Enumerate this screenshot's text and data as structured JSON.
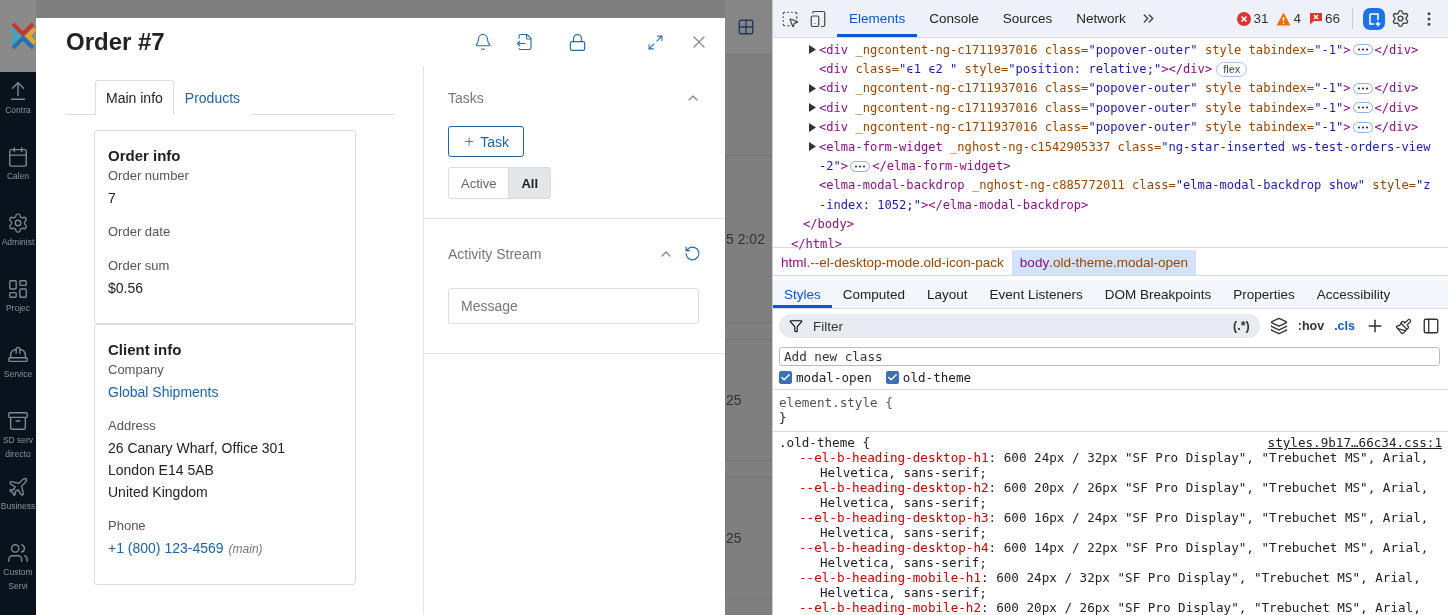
{
  "app_sidebar": {
    "items": [
      {
        "lines": [
          "Contra"
        ]
      },
      {
        "lines": [
          "Calen"
        ]
      },
      {
        "lines": [
          "Administ"
        ]
      },
      {
        "lines": [
          "Projec"
        ]
      },
      {
        "lines": [
          "Service"
        ]
      },
      {
        "lines": [
          "SD serv",
          "directo"
        ]
      },
      {
        "lines": [
          "Business"
        ]
      },
      {
        "lines": [
          "Custom",
          "Servi"
        ]
      }
    ]
  },
  "background": {
    "cards": [
      "5 2:02",
      "25",
      "25"
    ]
  },
  "modal": {
    "title": "Order #7",
    "tabs": [
      {
        "label": "Main info",
        "selected": true
      },
      {
        "label": "Products",
        "selected": false
      }
    ],
    "cards": [
      {
        "title": "Order info",
        "fields": [
          {
            "label": "Order number",
            "lines": [
              "7"
            ],
            "kind": "text"
          },
          {
            "label": "Order date"
          },
          {
            "label": "Order sum",
            "lines": [
              "$0.56"
            ],
            "kind": "text"
          }
        ]
      },
      {
        "title": "Client info",
        "fields": [
          {
            "label": "Company",
            "lines": [
              "Global Shipments"
            ],
            "kind": "link"
          },
          {
            "label": "Address",
            "lines": [
              "26 Canary Wharf, Office 301",
              "London E14 5AB",
              "United Kingdom"
            ],
            "kind": "text"
          },
          {
            "label": "Phone",
            "lines": [
              "+1 (800) 123-4569"
            ],
            "note": "(main)",
            "kind": "link"
          }
        ]
      }
    ],
    "tasks": {
      "title": "Tasks",
      "expanded": true,
      "add_button": "Task",
      "filters": [
        {
          "label": "Active",
          "selected": false
        },
        {
          "label": "All",
          "selected": true
        }
      ]
    },
    "activity": {
      "title": "Activity Stream",
      "expanded": true,
      "message_placeholder": "Message"
    }
  },
  "devtools": {
    "tabs": [
      {
        "label": "Elements",
        "selected": true
      },
      {
        "label": "Console",
        "selected": false
      },
      {
        "label": "Sources",
        "selected": false
      },
      {
        "label": "Network",
        "selected": false
      }
    ],
    "counters": [
      {
        "kind": "error",
        "count": "31"
      },
      {
        "kind": "warning",
        "count": "4"
      },
      {
        "kind": "issue",
        "count": "66"
      }
    ],
    "dom_lines": [
      {
        "kind": "expandable",
        "segments": [
          {
            "kind": "code",
            "tokens": [
              {
                "kind": "tag",
                "text": "<div"
              },
              {
                "kind": "attr",
                "text": " _ngcontent-ng-c1711937016 class="
              },
              {
                "kind": "value",
                "text": "\"popover-outer\""
              },
              {
                "kind": "attr",
                "text": " style tabindex="
              },
              {
                "kind": "value",
                "text": "\"-1\""
              },
              {
                "kind": "tag",
                "text": ">"
              }
            ]
          },
          {
            "kind": "ellipsis"
          },
          {
            "kind": "code",
            "tokens": [
              {
                "kind": "tag",
                "text": "</div>"
              }
            ]
          }
        ]
      },
      {
        "kind": "plain",
        "segments": [
          {
            "kind": "code",
            "tokens": [
              {
                "kind": "tag",
                "text": "<div"
              },
              {
                "kind": "attr",
                "text": " class="
              },
              {
                "kind": "value",
                "text": "\"ϵ1 ϵ2 \""
              },
              {
                "kind": "attr",
                "text": " style="
              },
              {
                "kind": "value",
                "text": "\"position: relative;\""
              },
              {
                "kind": "tag",
                "text": "></div>"
              }
            ]
          },
          {
            "kind": "badge",
            "text": "flex"
          }
        ]
      },
      {
        "kind": "expandable",
        "segments": [
          {
            "kind": "code",
            "tokens": [
              {
                "kind": "tag",
                "text": "<div"
              },
              {
                "kind": "attr",
                "text": " _ngcontent-ng-c1711937016 class="
              },
              {
                "kind": "value",
                "text": "\"popover-outer\""
              },
              {
                "kind": "attr",
                "text": " style tabindex="
              },
              {
                "kind": "value",
                "text": "\"-1\""
              },
              {
                "kind": "tag",
                "text": ">"
              }
            ]
          },
          {
            "kind": "ellipsis"
          },
          {
            "kind": "code",
            "tokens": [
              {
                "kind": "tag",
                "text": "</div>"
              }
            ]
          }
        ]
      },
      {
        "kind": "expandable",
        "segments": [
          {
            "kind": "code",
            "tokens": [
              {
                "kind": "tag",
                "text": "<div"
              },
              {
                "kind": "attr",
                "text": " _ngcontent-ng-c1711937016 class="
              },
              {
                "kind": "value",
                "text": "\"popover-outer\""
              },
              {
                "kind": "attr",
                "text": " style tabindex="
              },
              {
                "kind": "value",
                "text": "\"-1\""
              },
              {
                "kind": "tag",
                "text": ">"
              }
            ]
          },
          {
            "kind": "ellipsis"
          },
          {
            "kind": "code",
            "tokens": [
              {
                "kind": "tag",
                "text": "</div>"
              }
            ]
          }
        ]
      },
      {
        "kind": "expandable",
        "segments": [
          {
            "kind": "code",
            "tokens": [
              {
                "kind": "tag",
                "text": "<div"
              },
              {
                "kind": "attr",
                "text": " _ngcontent-ng-c1711937016 class="
              },
              {
                "kind": "value",
                "text": "\"popover-outer\""
              },
              {
                "kind": "attr",
                "text": " style tabindex="
              },
              {
                "kind": "value",
                "text": "\"-1\""
              },
              {
                "kind": "tag",
                "text": ">"
              }
            ]
          },
          {
            "kind": "ellipsis"
          },
          {
            "kind": "code",
            "tokens": [
              {
                "kind": "tag",
                "text": "</div>"
              }
            ]
          }
        ]
      },
      {
        "kind": "expandable",
        "segments": [
          {
            "kind": "code",
            "tokens": [
              {
                "kind": "tag",
                "text": "<elma-form-widget"
              },
              {
                "kind": "attr",
                "text": " _nghost-ng-c1542905337 class="
              },
              {
                "kind": "value",
                "text": "\"ng-star-inserted ws-test-orders-view"
              }
            ]
          }
        ]
      },
      {
        "kind": "wrap",
        "segments": [
          {
            "kind": "code",
            "tokens": [
              {
                "kind": "value",
                "text": "-2\""
              },
              {
                "kind": "tag",
                "text": ">"
              }
            ]
          },
          {
            "kind": "ellipsis"
          },
          {
            "kind": "code",
            "tokens": [
              {
                "kind": "tag",
                "text": "</elma-form-widget>"
              }
            ]
          }
        ]
      },
      {
        "kind": "plain",
        "segments": [
          {
            "kind": "code",
            "tokens": [
              {
                "kind": "tag",
                "text": "<elma-modal-backdrop"
              },
              {
                "kind": "attr",
                "text": " _nghost-ng-c885772011 class="
              },
              {
                "kind": "value",
                "text": "\"elma-modal-backdrop show\""
              },
              {
                "kind": "attr",
                "text": " style="
              },
              {
                "kind": "value",
                "text": "\"z"
              }
            ]
          }
        ]
      },
      {
        "kind": "wrap",
        "segments": [
          {
            "kind": "code",
            "tokens": [
              {
                "kind": "value",
                "text": "-index: 1052;\""
              },
              {
                "kind": "tag",
                "text": "></elma-modal-backdrop>"
              }
            ]
          }
        ]
      },
      {
        "kind": "body",
        "segments": [
          {
            "kind": "code",
            "tokens": [
              {
                "kind": "tag",
                "text": "</body>"
              }
            ]
          }
        ]
      },
      {
        "kind": "html",
        "segments": [
          {
            "kind": "code",
            "tokens": [
              {
                "kind": "tag",
                "text": "</html>"
              }
            ]
          }
        ]
      }
    ],
    "breadcrumbs": [
      {
        "tag": "html",
        "classes": ".--el-desktop-mode.old-icon-pack",
        "selected": false
      },
      {
        "tag": "body",
        "classes": ".old-theme.modal-open",
        "selected": true
      }
    ],
    "pane_tabs": [
      {
        "label": "Styles",
        "selected": true
      },
      {
        "label": "Computed",
        "selected": false
      },
      {
        "label": "Layout",
        "selected": false
      },
      {
        "label": "Event Listeners",
        "selected": false
      },
      {
        "label": "DOM Breakpoints",
        "selected": false
      },
      {
        "label": "Properties",
        "selected": false
      },
      {
        "label": "Accessibility",
        "selected": false
      }
    ],
    "filter": {
      "placeholder": "Filter",
      "regex": "(.*)",
      "hov": ":hov",
      "cls": ".cls"
    },
    "class_input": {
      "placeholder": "Add new class"
    },
    "classes": [
      {
        "label": "modal-open",
        "checked": true
      },
      {
        "label": "old-theme",
        "checked": true
      }
    ],
    "element_style": {
      "open": "element.style {",
      "close": "}"
    },
    "rule": {
      "selector": ".old-theme {",
      "source": "styles.9b17…66c34.css:1",
      "properties": [
        {
          "name": "--el-b-heading-desktop-h1",
          "value": ": 600 24px / 32px \"SF Pro Display\", \"Trebuchet MS\", Arial,",
          "continuation": "Helvetica, sans-serif;"
        },
        {
          "name": "--el-b-heading-desktop-h2",
          "value": ": 600 20px / 26px \"SF Pro Display\", \"Trebuchet MS\", Arial,",
          "continuation": "Helvetica, sans-serif;"
        },
        {
          "name": "--el-b-heading-desktop-h3",
          "value": ": 600 16px / 24px \"SF Pro Display\", \"Trebuchet MS\", Arial,",
          "continuation": "Helvetica, sans-serif;"
        },
        {
          "name": "--el-b-heading-desktop-h4",
          "value": ": 600 14px / 22px \"SF Pro Display\", \"Trebuchet MS\", Arial,",
          "continuation": "Helvetica, sans-serif;"
        },
        {
          "name": "--el-b-heading-mobile-h1",
          "value": ": 600 24px / 32px \"SF Pro Display\", \"Trebuchet MS\", Arial,",
          "continuation": "Helvetica, sans-serif;"
        },
        {
          "name": "--el-b-heading-mobile-h2",
          "value": ": 600 20px / 26px \"SF Pro Display\", \"Trebuchet MS\", Arial,"
        }
      ]
    }
  }
}
